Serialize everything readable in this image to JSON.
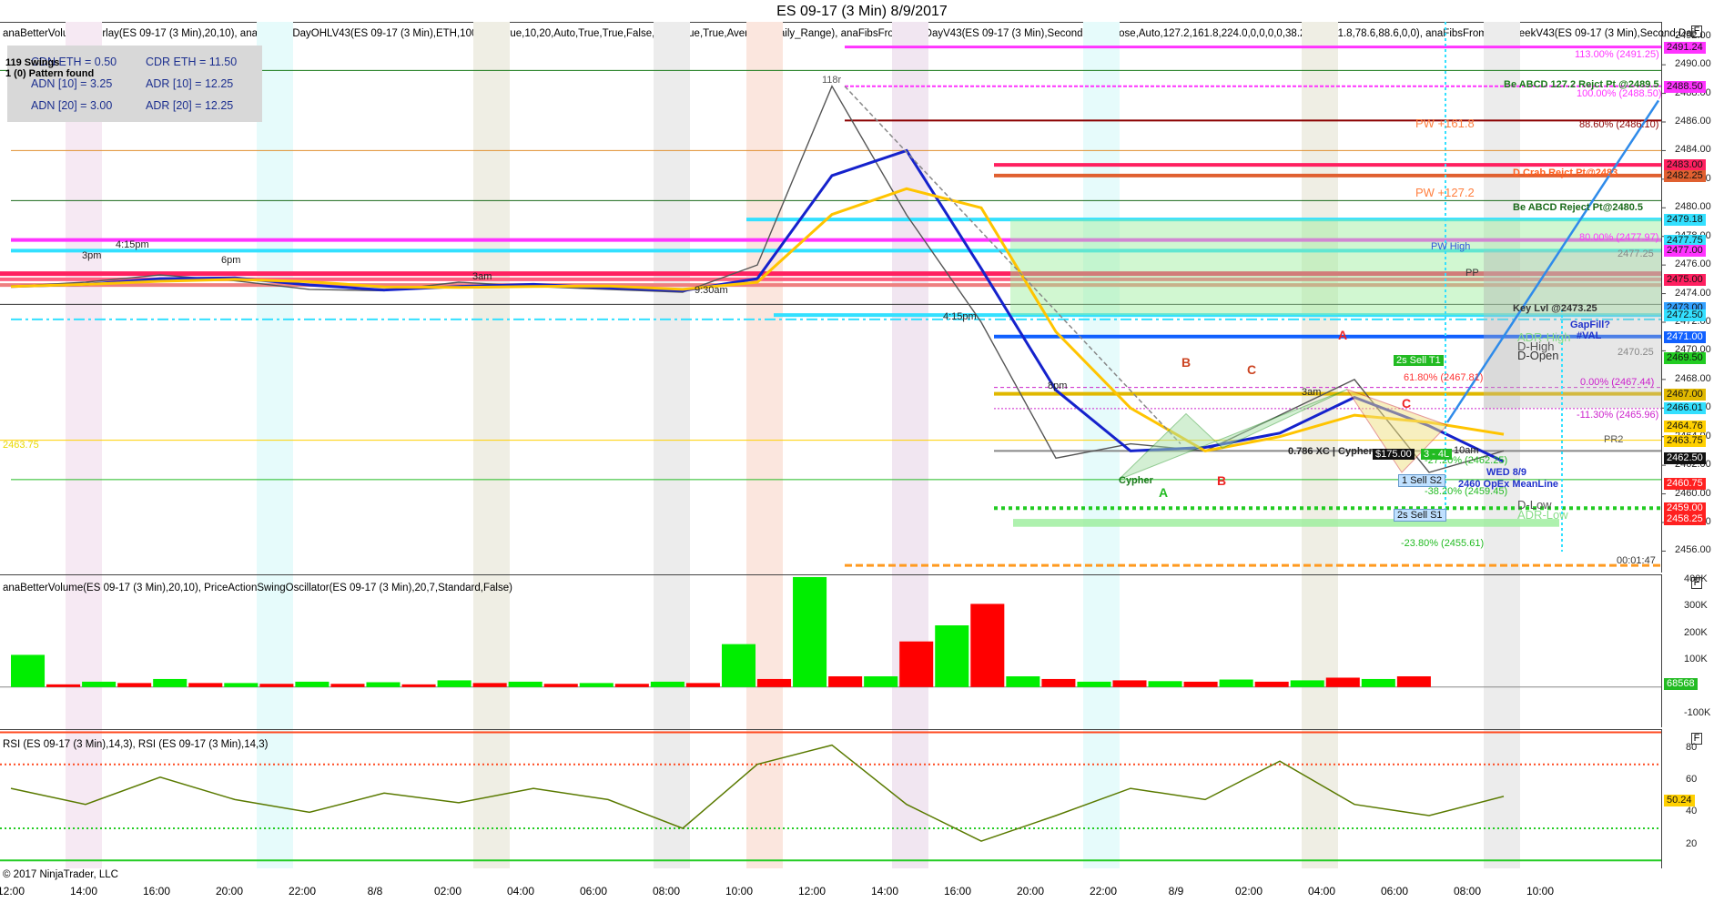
{
  "window_title": "ES 09-17 (3 Min)  8/9/2017",
  "price_panel": {
    "indicator_label": "anaBetterVolumeOverlay(ES 09-17 (3 Min),20,10), anaCurrentDayOHLV43(ES 09-17 (3 Min),ETH,100,100,True,10,20,Auto,True,True,False,True,True,True,Average_Daily_Range), anaFibsFromPriorDayV43(ES 09-17 (3 Min),Second,DailyClose,Auto,127.2,161.8,224.0,0,0,0,0,38.2,50.0,61.8,78.6,88.6,0,0), anaFibsFromPriorWeekV43(ES 09-17 (3 Min),Second,Dai",
    "info_box": {
      "cdn_eth": "CDN ETH = 0.50",
      "cdr_eth": "CDR ETH = 11.50",
      "adn10": "ADN [10] = 3.25",
      "adr10": "ADR [10] = 12.25",
      "adn20": "ADN [20] = 3.00",
      "adr20": "ADR [20] = 12.25"
    },
    "swings": "119 Swings",
    "pattern": "1 (0) Pattern found",
    "left_price_marker": "2463.75",
    "labels": {
      "l118r": "118r",
      "be_abcd_127": "Be ABCD 127.2 Rejct Pt @2489.5",
      "pct_100": "100.00% (2488.50)",
      "pct_113": "113.00% (2491.25)",
      "pw_1618": "PW +161.8",
      "pct_886": "88.60% (2486.10)",
      "d_crab": "D Crab Rejct Pt@2483",
      "pw_1272": "PW +127.2",
      "be_abcd_reject": "Be ABCD Reject Pt@2480.5",
      "pct_80": "80.00% (2477.97)",
      "level_2477": "2477.25",
      "prior_high": "PW High",
      "pp": "PP",
      "key_level": "Key Lvl @2473.25",
      "gap_fill": "GapFill?",
      "val": "#VAL",
      "adr_high": "ADR-High",
      "d_high": "D-High",
      "d_open": "D-Open",
      "level_2470": "2470.25",
      "sell_t1": "2s  Sell T1",
      "pct_618": "61.80% (2467.81)",
      "pct_0": "0.00% (2467.44)",
      "pct_neg113": "-11.30% (2465.96)",
      "pr2": "PR2",
      "xc_cypher": "0.786 XC | Cypher",
      "pnl": "$175.00",
      "pnl_ratio": "3 - 4L",
      "pct_neg272": "-27.20% (2462.25)",
      "wed": "WED 8/9",
      "opex": "2460 OpEx MeanLine",
      "sell_s2": "1  Sell S2",
      "pct_neg382": "-38.20% (2459.45)",
      "d_low": "D-Low",
      "sell_s1": "2s  Sell S1",
      "adr_low": "ADR-Low",
      "pct_neg238": "-23.80% (2455.61)",
      "timer": "00:01:47",
      "cypher": "Cypher",
      "pt_a1": "A",
      "pt_b1": "B",
      "pt_c1": "C",
      "pt_a2": "A",
      "pt_b2": "B",
      "pt_c2": "C",
      "t415pm": "4:15pm",
      "t3pm": "3pm",
      "t6pm": "6pm",
      "t3am": "3am",
      "t930am": "9:30am",
      "t415pm2": "4:15pm",
      "t8pm": "8pm",
      "t3am2": "3am",
      "t10am": "10am"
    },
    "axis_ticks": [
      "2492.00",
      "2490.00",
      "2488.00",
      "2486.00",
      "2484.00",
      "2482.00",
      "2480.00",
      "2478.00",
      "2476.00",
      "2474.00",
      "2472.00",
      "2470.00",
      "2468.00",
      "2466.00",
      "2464.00",
      "2462.00",
      "2460.00",
      "2458.00",
      "2456.00"
    ],
    "price_tags": [
      {
        "text": "2491.24",
        "bg": "#ff33ff"
      },
      {
        "text": "2488.50",
        "bg": "#ff33ff"
      },
      {
        "text": "2483.00",
        "bg": "#ff2060"
      },
      {
        "text": "2482.25",
        "bg": "#e06030"
      },
      {
        "text": "2479.18",
        "bg": "#33e0ff"
      },
      {
        "text": "2477.75",
        "bg": "#33e0ff"
      },
      {
        "text": "2477.00",
        "bg": "#ff33ff"
      },
      {
        "text": "2475.00",
        "bg": "#ff2060"
      },
      {
        "text": "2473.00",
        "bg": "#33a0ff"
      },
      {
        "text": "2472.50",
        "bg": "#33e0ff"
      },
      {
        "text": "2471.00",
        "bg": "#1060ff"
      },
      {
        "text": "2469.50",
        "bg": "#22cc22"
      },
      {
        "text": "2467.00",
        "bg": "#e0b800"
      },
      {
        "text": "2466.01",
        "bg": "#33e0ff"
      },
      {
        "text": "2464.76",
        "bg": "#ffd000"
      },
      {
        "text": "2463.75",
        "bg": "#ffd000"
      },
      {
        "text": "2462.50",
        "bg": "#111111"
      },
      {
        "text": "2460.75",
        "bg": "#ff2020"
      },
      {
        "text": "2459.00",
        "bg": "#ff2020"
      },
      {
        "text": "2458.25",
        "bg": "#ff2020"
      }
    ],
    "chart_data": {
      "type": "line",
      "title": "ES 09-17 (3 Min)  8/9/2017",
      "x": [
        "8/7 12:00",
        "8/7 14:00",
        "8/7 16:00",
        "8/7 20:00",
        "8/7 22:00",
        "8/8 00:00",
        "8/8 02:00",
        "8/8 04:00",
        "8/8 06:00",
        "8/8 08:00",
        "8/8 10:00",
        "8/8 12:00",
        "8/8 14:00",
        "8/8 16:00",
        "8/8 20:00",
        "8/8 22:00",
        "8/9 00:00",
        "8/9 02:00",
        "8/9 04:00",
        "8/9 06:00",
        "8/9 07:30"
      ],
      "series": [
        {
          "values": [
            2474.5,
            2474.8,
            2475.3,
            2474.9,
            2474.3,
            2474.2,
            2474.8,
            2474.5,
            2474.3,
            2474.1,
            2476.0,
            2488.5,
            2479.5,
            2472.0,
            2462.5,
            2463.5,
            2463.0,
            2465.5,
            2468.0,
            2461.5,
            2463.0
          ]
        }
      ],
      "ylim": [
        2454.5,
        2493.0
      ]
    }
  },
  "volume_panel": {
    "indicator_label": "anaBetterVolume(ES 09-17 (3 Min),20,10), PriceActionSwingOscillator(ES 09-17 (3 Min),20,7,Standard,False)",
    "axis_ticks": [
      "400K",
      "300K",
      "200K",
      "100K",
      "-100K"
    ],
    "last_tag": "68568",
    "chart_data": {
      "type": "bar",
      "categories": [
        "12:00",
        "14:00",
        "16:00",
        "20:00",
        "22:00",
        "8/8",
        "02:00",
        "04:00",
        "06:00",
        "08:00",
        "10:00",
        "12:00",
        "14:00",
        "16:00",
        "20:00",
        "22:00",
        "8/9",
        "02:00",
        "04:00",
        "06:00",
        "08:00"
      ],
      "series": [
        {
          "name": "up",
          "values": [
            120000,
            20000,
            30000,
            15000,
            20000,
            18000,
            25000,
            20000,
            15000,
            20000,
            160000,
            410000,
            40000,
            230000,
            40000,
            20000,
            22000,
            28000,
            25000,
            30000,
            0
          ]
        },
        {
          "name": "down",
          "values": [
            10000,
            15000,
            15000,
            12000,
            12000,
            10000,
            15000,
            12000,
            12000,
            15000,
            30000,
            40000,
            170000,
            310000,
            30000,
            25000,
            20000,
            20000,
            35000,
            40000,
            0
          ]
        }
      ],
      "ylim": [
        -150000,
        420000
      ]
    }
  },
  "rsi_panel": {
    "indicator_label": "RSI (ES 09-17 (3 Min),14,3), RSI (ES 09-17 (3 Min),14,3)",
    "axis_ticks": [
      "80",
      "60",
      "40",
      "20"
    ],
    "last_tag": "50.24",
    "chart_data": {
      "type": "line",
      "x": [
        "12:00",
        "14:00",
        "16:00",
        "20:00",
        "22:00",
        "8/8",
        "02:00",
        "04:00",
        "06:00",
        "08:00",
        "10:00",
        "12:00",
        "14:00",
        "16:00",
        "20:00",
        "22:00",
        "8/9",
        "02:00",
        "04:00",
        "06:00",
        "07:30"
      ],
      "series": [
        {
          "name": "RSI",
          "values": [
            55,
            45,
            62,
            48,
            40,
            52,
            46,
            55,
            48,
            30,
            70,
            82,
            45,
            22,
            38,
            55,
            48,
            72,
            45,
            38,
            50
          ]
        }
      ],
      "ylim": [
        5,
        92
      ]
    }
  },
  "x_axis": [
    "12:00",
    "14:00",
    "16:00",
    "20:00",
    "22:00",
    "8/8",
    "02:00",
    "04:00",
    "06:00",
    "08:00",
    "10:00",
    "12:00",
    "14:00",
    "16:00",
    "20:00",
    "22:00",
    "8/9",
    "02:00",
    "04:00",
    "06:00",
    "08:00",
    "10:00"
  ],
  "copyright": "© 2017 NinjaTrader, LLC",
  "colors": {
    "up": "#00ee00",
    "down": "#ff0000",
    "accent_magenta": "#ff33ff",
    "accent_cyan": "#33e0ff",
    "rsi": "#5a7a00"
  }
}
